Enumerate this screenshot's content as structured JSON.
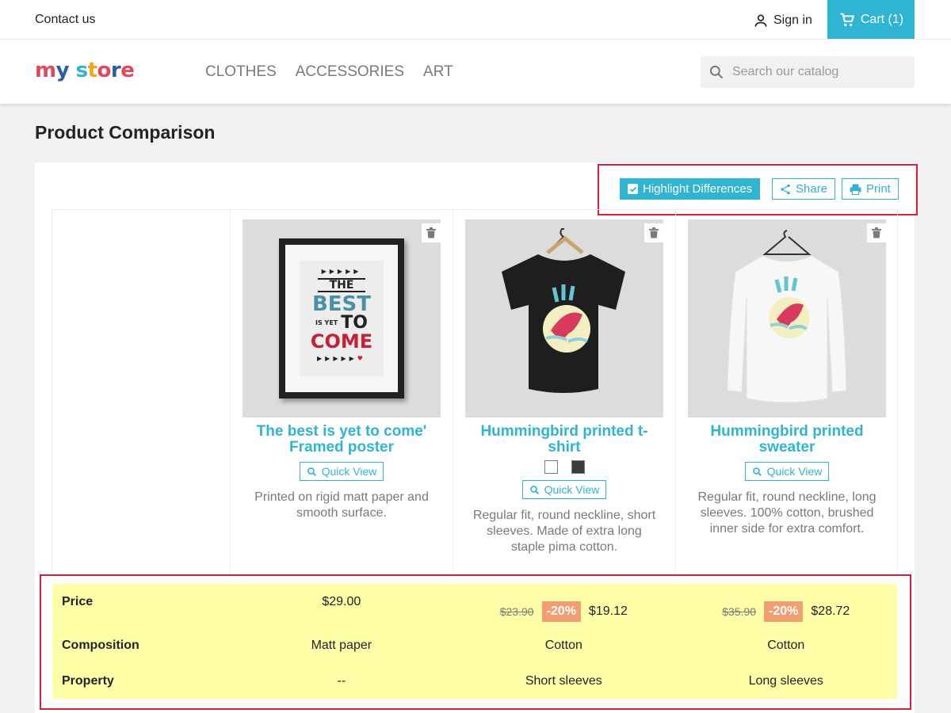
{
  "topbar": {
    "contact": "Contact us",
    "signin": "Sign in",
    "cart": "Cart (1)"
  },
  "header": {
    "logo": {
      "parts": [
        "m",
        "y",
        " ",
        "s",
        "t",
        "o",
        "r",
        "e"
      ]
    },
    "nav": [
      "CLOTHES",
      "ACCESSORIES",
      "ART"
    ],
    "search_placeholder": "Search our catalog"
  },
  "page_title": "Product Comparison",
  "toolbar": {
    "highlight": "Highlight Differences",
    "share": "Share",
    "print": "Print"
  },
  "products": [
    {
      "name": "The best is yet to come' Framed poster",
      "quick_view": "Quick View",
      "desc": "Printed on rigid matt paper and smooth surface.",
      "poster_lines": [
        "THE",
        "BEST",
        "IS YET",
        "TO",
        "COME"
      ]
    },
    {
      "name": "Hummingbird printed t-shirt",
      "quick_view": "Quick View",
      "desc": "Regular fit, round neckline, short sleeves. Made of extra long staple pima cotton.",
      "swatches": [
        "#ffffff",
        "#3b3b3b"
      ]
    },
    {
      "name": "Hummingbird printed sweater",
      "quick_view": "Quick View",
      "desc": "Regular fit, round neckline, long sleeves. 100% cotton, brushed inner side for extra comfort."
    }
  ],
  "features": {
    "price_label": "Price",
    "composition_label": "Composition",
    "property_label": "Property",
    "prices": [
      {
        "price": "$29.00"
      },
      {
        "old": "$23.90",
        "discount": "-20%",
        "price": "$19.12"
      },
      {
        "old": "$35.90",
        "discount": "-20%",
        "price": "$28.72"
      }
    ],
    "composition": [
      "Matt paper",
      "Cotton",
      "Cotton"
    ],
    "property": [
      "--",
      "Short sleeves",
      "Long sleeves"
    ]
  },
  "colors": {
    "accent": "#2fb5d2",
    "highlight": "#ffffa8",
    "discount": "#f39d72",
    "annotation": "#d0223a"
  }
}
